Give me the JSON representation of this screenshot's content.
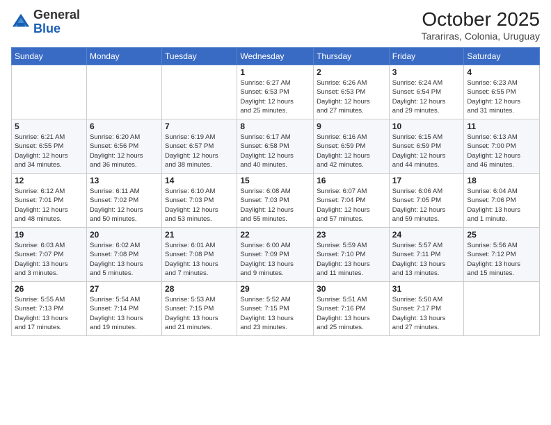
{
  "header": {
    "logo_general": "General",
    "logo_blue": "Blue",
    "month_title": "October 2025",
    "location": "Tarariras, Colonia, Uruguay"
  },
  "weekdays": [
    "Sunday",
    "Monday",
    "Tuesday",
    "Wednesday",
    "Thursday",
    "Friday",
    "Saturday"
  ],
  "weeks": [
    [
      {
        "day": "",
        "info": ""
      },
      {
        "day": "",
        "info": ""
      },
      {
        "day": "",
        "info": ""
      },
      {
        "day": "1",
        "info": "Sunrise: 6:27 AM\nSunset: 6:53 PM\nDaylight: 12 hours\nand 25 minutes."
      },
      {
        "day": "2",
        "info": "Sunrise: 6:26 AM\nSunset: 6:53 PM\nDaylight: 12 hours\nand 27 minutes."
      },
      {
        "day": "3",
        "info": "Sunrise: 6:24 AM\nSunset: 6:54 PM\nDaylight: 12 hours\nand 29 minutes."
      },
      {
        "day": "4",
        "info": "Sunrise: 6:23 AM\nSunset: 6:55 PM\nDaylight: 12 hours\nand 31 minutes."
      }
    ],
    [
      {
        "day": "5",
        "info": "Sunrise: 6:21 AM\nSunset: 6:55 PM\nDaylight: 12 hours\nand 34 minutes."
      },
      {
        "day": "6",
        "info": "Sunrise: 6:20 AM\nSunset: 6:56 PM\nDaylight: 12 hours\nand 36 minutes."
      },
      {
        "day": "7",
        "info": "Sunrise: 6:19 AM\nSunset: 6:57 PM\nDaylight: 12 hours\nand 38 minutes."
      },
      {
        "day": "8",
        "info": "Sunrise: 6:17 AM\nSunset: 6:58 PM\nDaylight: 12 hours\nand 40 minutes."
      },
      {
        "day": "9",
        "info": "Sunrise: 6:16 AM\nSunset: 6:59 PM\nDaylight: 12 hours\nand 42 minutes."
      },
      {
        "day": "10",
        "info": "Sunrise: 6:15 AM\nSunset: 6:59 PM\nDaylight: 12 hours\nand 44 minutes."
      },
      {
        "day": "11",
        "info": "Sunrise: 6:13 AM\nSunset: 7:00 PM\nDaylight: 12 hours\nand 46 minutes."
      }
    ],
    [
      {
        "day": "12",
        "info": "Sunrise: 6:12 AM\nSunset: 7:01 PM\nDaylight: 12 hours\nand 48 minutes."
      },
      {
        "day": "13",
        "info": "Sunrise: 6:11 AM\nSunset: 7:02 PM\nDaylight: 12 hours\nand 50 minutes."
      },
      {
        "day": "14",
        "info": "Sunrise: 6:10 AM\nSunset: 7:03 PM\nDaylight: 12 hours\nand 53 minutes."
      },
      {
        "day": "15",
        "info": "Sunrise: 6:08 AM\nSunset: 7:03 PM\nDaylight: 12 hours\nand 55 minutes."
      },
      {
        "day": "16",
        "info": "Sunrise: 6:07 AM\nSunset: 7:04 PM\nDaylight: 12 hours\nand 57 minutes."
      },
      {
        "day": "17",
        "info": "Sunrise: 6:06 AM\nSunset: 7:05 PM\nDaylight: 12 hours\nand 59 minutes."
      },
      {
        "day": "18",
        "info": "Sunrise: 6:04 AM\nSunset: 7:06 PM\nDaylight: 13 hours\nand 1 minute."
      }
    ],
    [
      {
        "day": "19",
        "info": "Sunrise: 6:03 AM\nSunset: 7:07 PM\nDaylight: 13 hours\nand 3 minutes."
      },
      {
        "day": "20",
        "info": "Sunrise: 6:02 AM\nSunset: 7:08 PM\nDaylight: 13 hours\nand 5 minutes."
      },
      {
        "day": "21",
        "info": "Sunrise: 6:01 AM\nSunset: 7:08 PM\nDaylight: 13 hours\nand 7 minutes."
      },
      {
        "day": "22",
        "info": "Sunrise: 6:00 AM\nSunset: 7:09 PM\nDaylight: 13 hours\nand 9 minutes."
      },
      {
        "day": "23",
        "info": "Sunrise: 5:59 AM\nSunset: 7:10 PM\nDaylight: 13 hours\nand 11 minutes."
      },
      {
        "day": "24",
        "info": "Sunrise: 5:57 AM\nSunset: 7:11 PM\nDaylight: 13 hours\nand 13 minutes."
      },
      {
        "day": "25",
        "info": "Sunrise: 5:56 AM\nSunset: 7:12 PM\nDaylight: 13 hours\nand 15 minutes."
      }
    ],
    [
      {
        "day": "26",
        "info": "Sunrise: 5:55 AM\nSunset: 7:13 PM\nDaylight: 13 hours\nand 17 minutes."
      },
      {
        "day": "27",
        "info": "Sunrise: 5:54 AM\nSunset: 7:14 PM\nDaylight: 13 hours\nand 19 minutes."
      },
      {
        "day": "28",
        "info": "Sunrise: 5:53 AM\nSunset: 7:15 PM\nDaylight: 13 hours\nand 21 minutes."
      },
      {
        "day": "29",
        "info": "Sunrise: 5:52 AM\nSunset: 7:15 PM\nDaylight: 13 hours\nand 23 minutes."
      },
      {
        "day": "30",
        "info": "Sunrise: 5:51 AM\nSunset: 7:16 PM\nDaylight: 13 hours\nand 25 minutes."
      },
      {
        "day": "31",
        "info": "Sunrise: 5:50 AM\nSunset: 7:17 PM\nDaylight: 13 hours\nand 27 minutes."
      },
      {
        "day": "",
        "info": ""
      }
    ]
  ]
}
